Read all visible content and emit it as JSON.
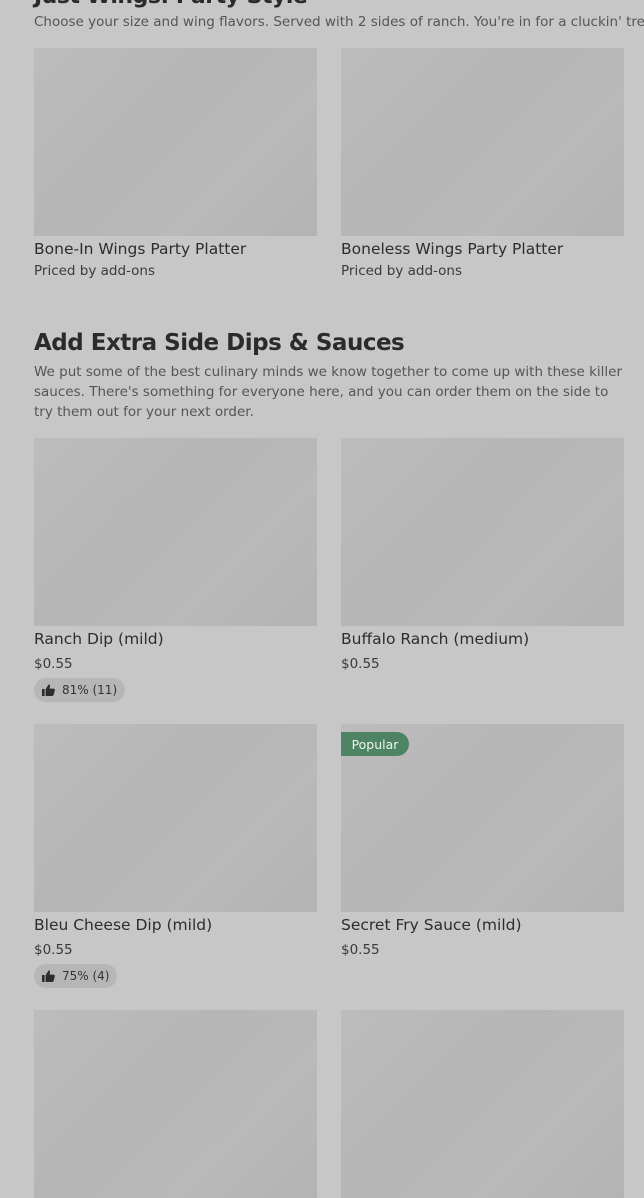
{
  "sections": [
    {
      "title": "Just Wings: Party Style",
      "description": "Choose your size and wing flavors. Served with 2 sides of ranch. You're in for a cluckin' treat!",
      "items": [
        {
          "name": "Bone-In Wings Party Platter",
          "price": "Priced by add-ons"
        },
        {
          "name": "Boneless Wings Party Platter",
          "price": "Priced by add-ons"
        }
      ]
    },
    {
      "title": "Add Extra Side Dips & Sauces",
      "description": "We put some of the best culinary minds we know together to come up with these killer sauces. There's something for everyone here, and you can order them on the side to try them out for your next order.",
      "items": [
        {
          "name": "Ranch Dip (mild)",
          "price": "$0.55",
          "rating": "81% (11)"
        },
        {
          "name": "Buffalo Ranch (medium)",
          "price": "$0.55"
        },
        {
          "name": "Bleu Cheese Dip (mild)",
          "price": "$0.55",
          "rating": "75% (4)"
        },
        {
          "name": "Secret Fry Sauce (mild)",
          "price": "$0.55",
          "badge": "Popular"
        }
      ]
    }
  ],
  "icons": {
    "rating": "thumbs-up-icon"
  }
}
